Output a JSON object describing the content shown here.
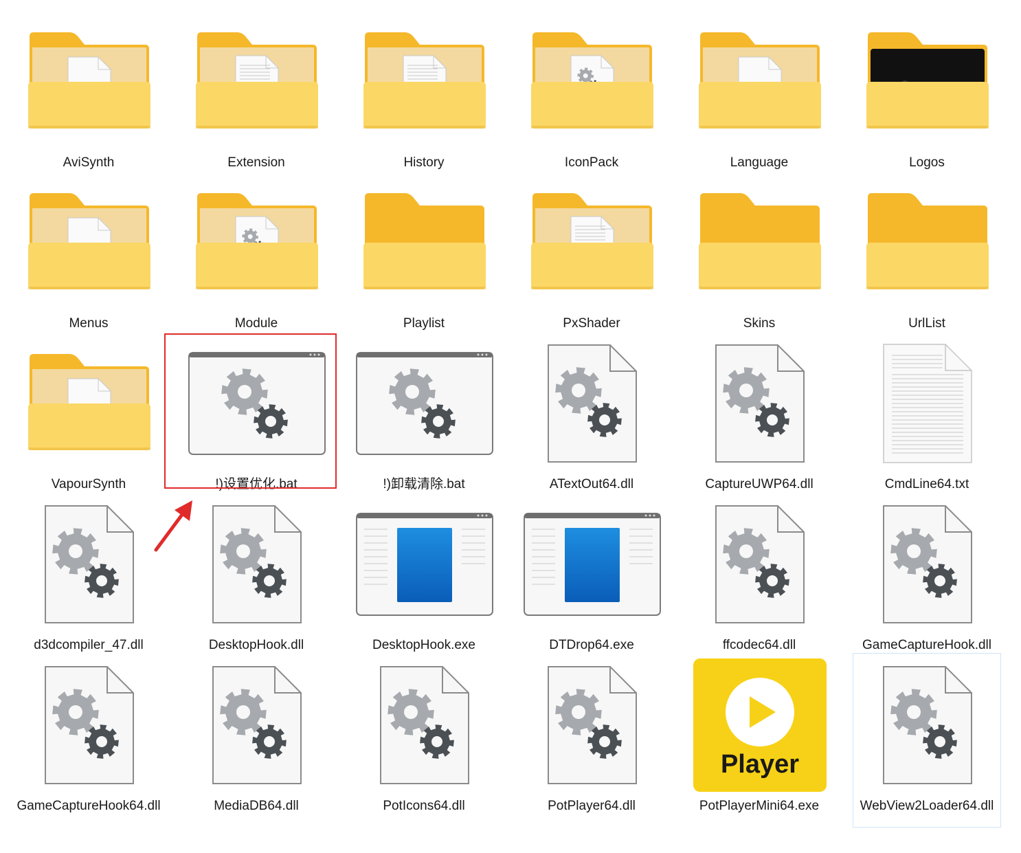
{
  "files": [
    {
      "name": "AviSynth",
      "icon": "folder-doc-icon"
    },
    {
      "name": "Extension",
      "icon": "folder-lines-icon"
    },
    {
      "name": "History",
      "icon": "folder-lines-icon"
    },
    {
      "name": "IconPack",
      "icon": "folder-gear-icon"
    },
    {
      "name": "Language",
      "icon": "folder-doc-icon"
    },
    {
      "name": "Logos",
      "icon": "folder-dark-icon"
    },
    {
      "name": "Menus",
      "icon": "folder-doc-icon"
    },
    {
      "name": "Module",
      "icon": "folder-gear-icon"
    },
    {
      "name": "Playlist",
      "icon": "folder-empty-icon"
    },
    {
      "name": "PxShader",
      "icon": "folder-lines-icon"
    },
    {
      "name": "Skins",
      "icon": "folder-empty-icon"
    },
    {
      "name": "UrlList",
      "icon": "folder-empty-icon"
    },
    {
      "name": "VapourSynth",
      "icon": "folder-doc-icon"
    },
    {
      "name": "!)设置优化.bat",
      "icon": "batch-file-icon"
    },
    {
      "name": "!)卸载清除.bat",
      "icon": "batch-file-icon"
    },
    {
      "name": "ATextOut64.dll",
      "icon": "dll-file-icon"
    },
    {
      "name": "CaptureUWP64.dll",
      "icon": "dll-file-icon"
    },
    {
      "name": "CmdLine64.txt",
      "icon": "text-file-icon"
    },
    {
      "name": "d3dcompiler_47.dll",
      "icon": "dll-file-icon"
    },
    {
      "name": "DesktopHook.dll",
      "icon": "dll-file-icon"
    },
    {
      "name": "DesktopHook.exe",
      "icon": "app-window-icon"
    },
    {
      "name": "DTDrop64.exe",
      "icon": "app-window-icon"
    },
    {
      "name": "ffcodec64.dll",
      "icon": "dll-file-icon"
    },
    {
      "name": "GameCaptureHook.dll",
      "icon": "dll-file-icon"
    },
    {
      "name": "GameCaptureHook64.dll",
      "icon": "dll-file-icon"
    },
    {
      "name": "MediaDB64.dll",
      "icon": "dll-file-icon"
    },
    {
      "name": "PotIcons64.dll",
      "icon": "dll-file-icon"
    },
    {
      "name": "PotPlayer64.dll",
      "icon": "dll-file-icon"
    },
    {
      "name": "PotPlayerMini64.exe",
      "icon": "potplayer-logo-icon"
    },
    {
      "name": "WebView2Loader64.dll",
      "icon": "dll-file-icon"
    }
  ],
  "app_icon_text": "Player",
  "highlighted_item": "!)设置优化.bat",
  "selected_item": "WebView2Loader64.dll",
  "colors": {
    "highlight_border": "#e02b2b",
    "arrow": "#e02b2b",
    "selection_border": "#cfe3f7",
    "folder_front": "#fbd766",
    "folder_back": "#f5b82a",
    "potplayer_bg": "#f7d117"
  }
}
